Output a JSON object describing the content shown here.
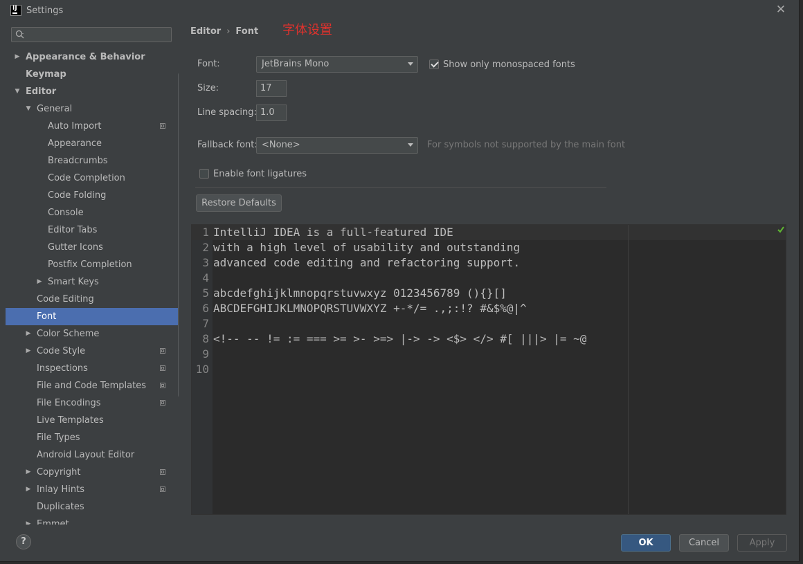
{
  "window": {
    "title": "Settings"
  },
  "search": {
    "placeholder": ""
  },
  "sidebar": {
    "items": [
      {
        "label": "Appearance & Behavior",
        "level": 0,
        "bold": true,
        "arrow": "right"
      },
      {
        "label": "Keymap",
        "level": 0,
        "bold": true,
        "arrow": ""
      },
      {
        "label": "Editor",
        "level": 0,
        "bold": true,
        "arrow": "down"
      },
      {
        "label": "General",
        "level": 1,
        "arrow": "down"
      },
      {
        "label": "Auto Import",
        "level": 2,
        "copy": true
      },
      {
        "label": "Appearance",
        "level": 2
      },
      {
        "label": "Breadcrumbs",
        "level": 2
      },
      {
        "label": "Code Completion",
        "level": 2
      },
      {
        "label": "Code Folding",
        "level": 2
      },
      {
        "label": "Console",
        "level": 2
      },
      {
        "label": "Editor Tabs",
        "level": 2
      },
      {
        "label": "Gutter Icons",
        "level": 2
      },
      {
        "label": "Postfix Completion",
        "level": 2
      },
      {
        "label": "Smart Keys",
        "level": 2,
        "arrow": "right"
      },
      {
        "label": "Code Editing",
        "level": 1
      },
      {
        "label": "Font",
        "level": 1,
        "selected": true
      },
      {
        "label": "Color Scheme",
        "level": 1,
        "arrow": "right"
      },
      {
        "label": "Code Style",
        "level": 1,
        "arrow": "right",
        "copy": true
      },
      {
        "label": "Inspections",
        "level": 1,
        "copy": true
      },
      {
        "label": "File and Code Templates",
        "level": 1,
        "copy": true
      },
      {
        "label": "File Encodings",
        "level": 1,
        "copy": true
      },
      {
        "label": "Live Templates",
        "level": 1
      },
      {
        "label": "File Types",
        "level": 1
      },
      {
        "label": "Android Layout Editor",
        "level": 1
      },
      {
        "label": "Copyright",
        "level": 1,
        "arrow": "right",
        "copy": true
      },
      {
        "label": "Inlay Hints",
        "level": 1,
        "arrow": "right",
        "copy": true
      },
      {
        "label": "Duplicates",
        "level": 1
      },
      {
        "label": "Emmet",
        "level": 1,
        "arrow": "right"
      }
    ]
  },
  "breadcrumb": {
    "part1": "Editor",
    "separator": "›",
    "part2": "Font"
  },
  "annotation": "字体设置",
  "font_settings": {
    "font_label": "Font:",
    "font_value": "JetBrains Mono",
    "mono_only_label": "Show only monospaced fonts",
    "mono_only_checked": true,
    "size_label": "Size:",
    "size_value": "17",
    "line_spacing_label": "Line spacing:",
    "line_spacing_value": "1.0",
    "fallback_label": "Fallback font:",
    "fallback_value": "<None>",
    "fallback_hint": "For symbols not supported by the main font",
    "ligatures_label": "Enable font ligatures",
    "ligatures_checked": false,
    "restore_label": "Restore Defaults"
  },
  "preview": {
    "line_numbers": [
      "1",
      "2",
      "3",
      "4",
      "5",
      "6",
      "7",
      "8",
      "9",
      "10"
    ],
    "lines": [
      "IntelliJ IDEA is a full-featured IDE",
      "with a high level of usability and outstanding",
      "advanced code editing and refactoring support.",
      "",
      "abcdefghijklmnopqrstuvwxyz 0123456789 (){}[]",
      "ABCDEFGHIJKLMNOPQRSTUVWXYZ +-*/= .,;:!? #&$%@|^",
      "",
      "<!-- -- != := === >= >- >=> |-> -> <$> </> #[ |||> |= ~@",
      "",
      ""
    ]
  },
  "footer": {
    "help_label": "?",
    "ok_label": "OK",
    "cancel_label": "Cancel",
    "apply_label": "Apply"
  },
  "colors": {
    "accent_selected": "#4b6eaf",
    "ok_button": "#365880",
    "annotation": "#e0322d",
    "status_ok": "#5fb832"
  }
}
